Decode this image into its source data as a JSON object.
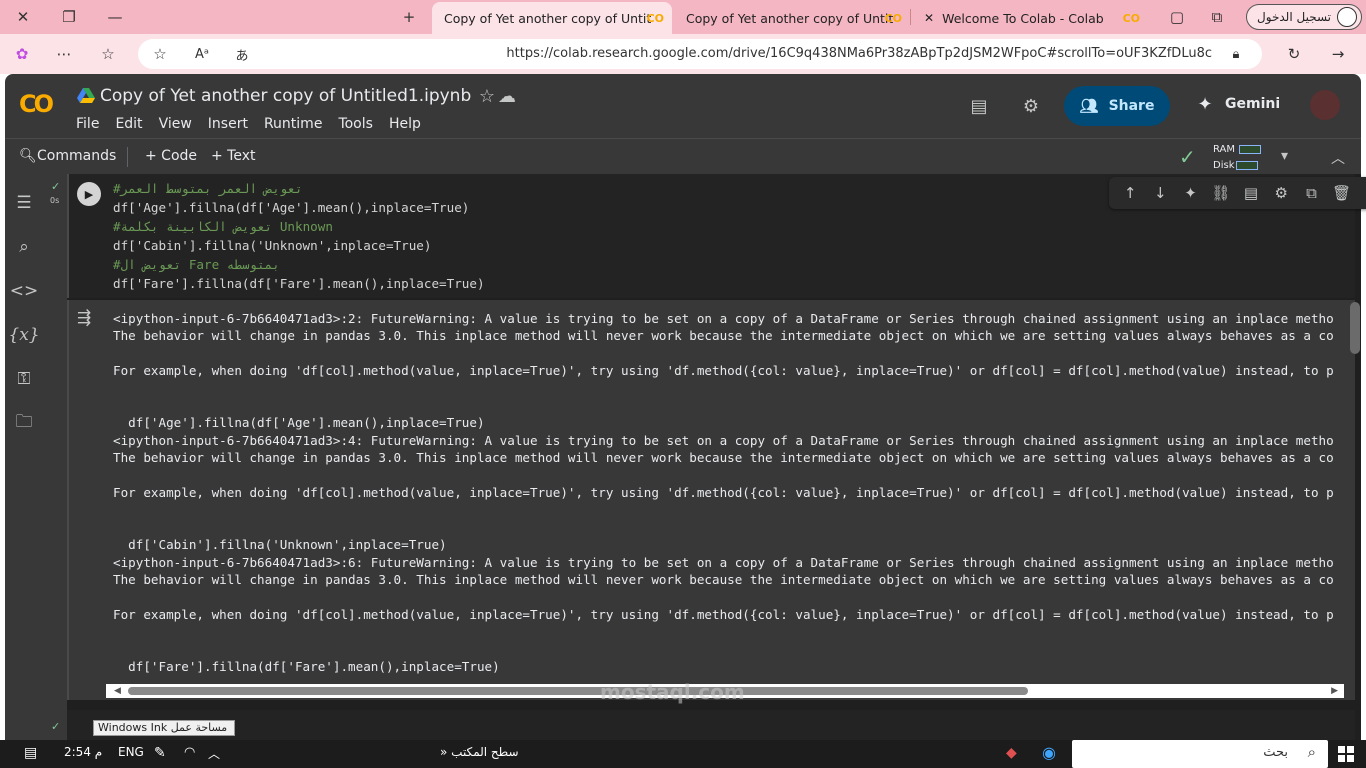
{
  "browser": {
    "tabs": [
      {
        "title": "Copy of Yet another copy of Untit"
      },
      {
        "title": "Copy of Yet another copy of Untit"
      },
      {
        "title": "Welcome To Colab - Colab"
      }
    ],
    "signin_label": "تسجيل الدخول",
    "url": "https://colab.research.google.com/drive/16C9q438NMa6Pr38zABpTp2dJSM2WFpoC#scrollTo=oUF3KZfDLu8c"
  },
  "colab": {
    "logo": "CO",
    "title": "Copy of Yet another copy of Untitled1.ipynb",
    "menu": [
      "File",
      "Edit",
      "View",
      "Insert",
      "Runtime",
      "Tools",
      "Help"
    ],
    "share_label": "Share",
    "gemini_label": "Gemini",
    "toolbar": {
      "commands": "Commands",
      "code": "+ Code",
      "text": "+ Text",
      "ram": "RAM",
      "disk": "Disk"
    }
  },
  "cell": {
    "exec_time": "0s",
    "code_lines": [
      "#تعويض العمر بمتوسط العمر",
      "df['Age'].fillna(df['Age'].mean(),inplace=True)",
      "#تعويض الكابينة بكلمة Unknown",
      "df['Cabin'].fillna('Unknown',inplace=True)",
      "#تعويض ال Fare بمتوسطه",
      "df['Fare'].fillna(df['Fare'].mean(),inplace=True)"
    ],
    "output": [
      "<ipython-input-6-7b6640471ad3>:2: FutureWarning: A value is trying to be set on a copy of a DataFrame or Series through chained assignment using an inplace metho",
      "The behavior will change in pandas 3.0. This inplace method will never work because the intermediate object on which we are setting values always behaves as a co",
      "",
      "For example, when doing 'df[col].method(value, inplace=True)', try using 'df.method({col: value}, inplace=True)' or df[col] = df[col].method(value) instead, to p",
      "",
      "",
      "  df['Age'].fillna(df['Age'].mean(),inplace=True)",
      "<ipython-input-6-7b6640471ad3>:4: FutureWarning: A value is trying to be set on a copy of a DataFrame or Series through chained assignment using an inplace metho",
      "The behavior will change in pandas 3.0. This inplace method will never work because the intermediate object on which we are setting values always behaves as a co",
      "",
      "For example, when doing 'df[col].method(value, inplace=True)', try using 'df.method({col: value}, inplace=True)' or df[col] = df[col].method(value) instead, to p",
      "",
      "",
      "  df['Cabin'].fillna('Unknown',inplace=True)",
      "<ipython-input-6-7b6640471ad3>:6: FutureWarning: A value is trying to be set on a copy of a DataFrame or Series through chained assignment using an inplace metho",
      "The behavior will change in pandas 3.0. This inplace method will never work because the intermediate object on which we are setting values always behaves as a co",
      "",
      "For example, when doing 'df[col].method(value, inplace=True)', try using 'df.method({col: value}, inplace=True)' or df[col] = df[col].method(value) instead, to p",
      "",
      "",
      "  df['Fare'].fillna(df['Fare'].mean(),inplace=True)"
    ],
    "next_cell_tooltip": "Windows Ink مساحة عمل"
  },
  "taskbar": {
    "time": "2:54 م",
    "lang": "ENG",
    "desktop_label": "سطح المكتب",
    "search_label": "بحث"
  },
  "watermark": "mostaql.com"
}
